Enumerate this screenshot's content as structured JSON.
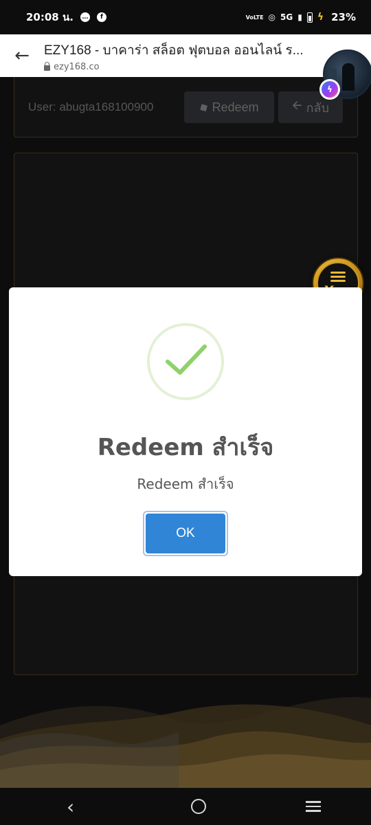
{
  "status_bar": {
    "time": "20:08 น.",
    "network": "5G",
    "volte": "VoLTE",
    "battery_pct": "23%"
  },
  "browser": {
    "title": "EZY168 - บาคาร่า สล็อต ฟุตบอล ออนไลน์ ร...",
    "url": "ezy168.co"
  },
  "page": {
    "user_label": "User: abugta168100900",
    "redeem_label": "Redeem",
    "back_label": "กลับ",
    "menu_label": "Menu"
  },
  "modal": {
    "title": "Redeem สำเร็จ",
    "text": "Redeem สำเร็จ",
    "ok_label": "OK"
  },
  "colors": {
    "ok_button": "#3085d6",
    "check": "#8fd16a",
    "panel_border": "#5a4a23",
    "menu_gold": "#e8b83a"
  },
  "icons": [
    "back-arrow-icon",
    "lock-icon",
    "messenger-icon",
    "ticket-icon",
    "arrow-left-icon",
    "menu-icon",
    "check-icon",
    "nav-back-icon",
    "nav-home-icon",
    "nav-recent-icon"
  ]
}
